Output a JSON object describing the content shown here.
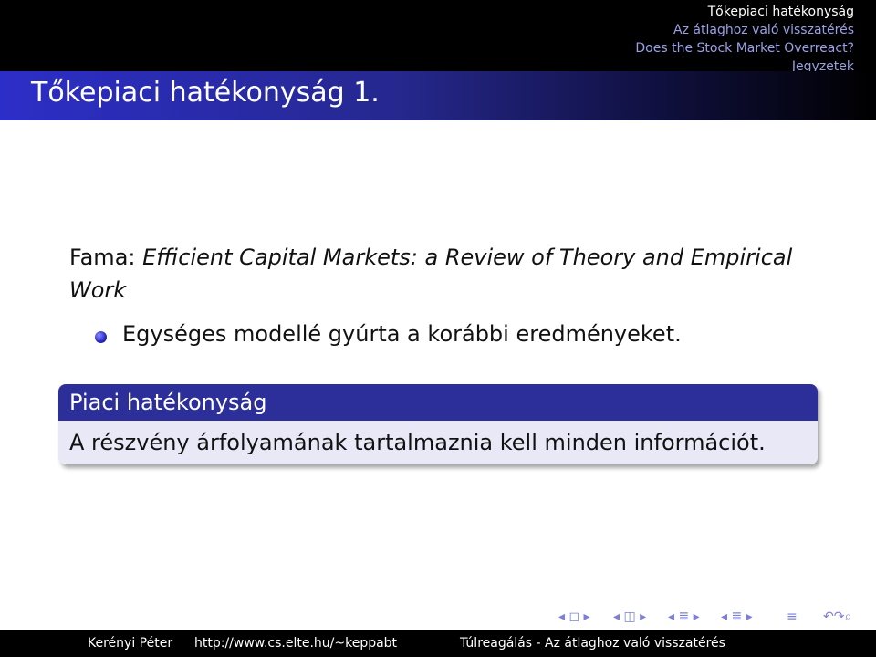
{
  "nav": {
    "items": [
      "Tőkepiaci hatékonyság",
      "Az átlaghoz való visszatérés",
      "Does the Stock Market Overreact?",
      "Jegyzetek"
    ],
    "active_index": 0
  },
  "slide": {
    "title": "Tőkepiaci hatékonyság 1.",
    "reference_prefix": "Fama: ",
    "reference_title": "Efficient Capital Markets: a Review of Theory and Empirical Work",
    "bullet": "Egységes modellé gyúrta a korábbi eredményeket.",
    "block_title": "Piaci hatékonyság",
    "block_body": "A részvény árfolyamának tartalmaznia kell minden információt."
  },
  "nav_symbols": {
    "frame": "◂ ◻ ▸",
    "subsection": "◂ ◫ ▸",
    "section": "◂ ≣ ▸",
    "subsection2": "◂ ≣ ▸",
    "align": "≡",
    "search": "↶↷⌕"
  },
  "footer": {
    "author": "Kerényi Péter",
    "url": "http://www.cs.elte.hu/~keppabt",
    "section": "Túlreagálás - Az átlaghoz való visszatérés"
  },
  "colors": {
    "accent": "#2c2e99",
    "block_body_bg": "#e8e8f7",
    "nav_inactive": "#9aa0e8"
  }
}
